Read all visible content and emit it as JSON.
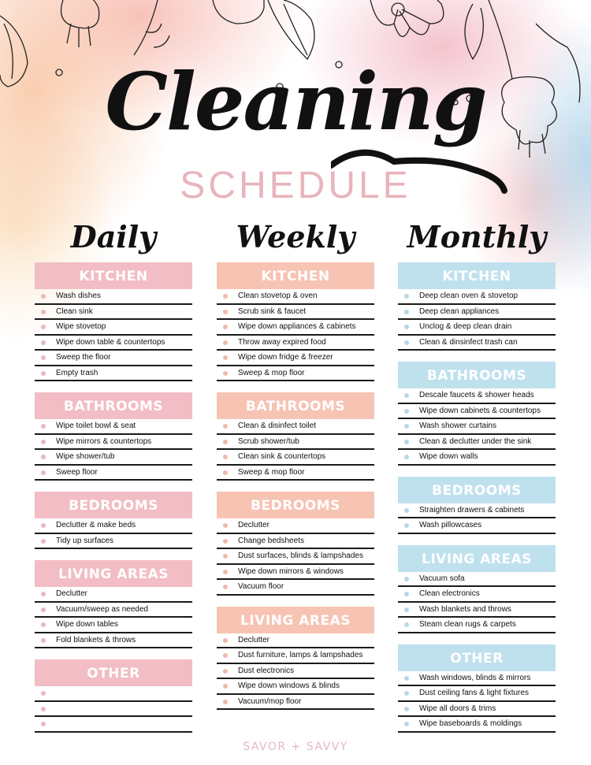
{
  "title": "Cleaning",
  "subtitle": "SCHEDULE",
  "footer": "SAVOR + SAVVY",
  "colors": {
    "daily_accent": "#f2bdc4",
    "weekly_accent": "#f7c3b3",
    "monthly_accent": "#bfe1ee",
    "subtitle": "#e8b4bc"
  },
  "icons": {
    "decor": "floral-line-art",
    "bullet": "dot"
  },
  "columns": [
    {
      "title": "Daily",
      "sections": [
        {
          "heading": "KITCHEN",
          "items": [
            "Wash dishes",
            "Clean sink",
            "Wipe stovetop",
            "Wipe down table & countertops",
            "Sweep the floor",
            "Empty trash"
          ]
        },
        {
          "heading": "BATHROOMS",
          "items": [
            "Wipe toilet bowl & seat",
            "Wipe mirrors & countertops",
            "Wipe shower/tub",
            "Sweep floor"
          ]
        },
        {
          "heading": "BEDROOMS",
          "items": [
            "Declutter & make beds",
            "Tidy up surfaces"
          ]
        },
        {
          "heading": "LIVING AREAS",
          "items": [
            "Declutter",
            "Vacuum/sweep as needed",
            "Wipe down tables",
            "Fold blankets & throws"
          ]
        },
        {
          "heading": "OTHER",
          "items": [
            "",
            "",
            ""
          ]
        }
      ]
    },
    {
      "title": "Weekly",
      "sections": [
        {
          "heading": "KITCHEN",
          "items": [
            "Clean stovetop & oven",
            "Scrub  sink & faucet",
            "Wipe down appliances & cabinets",
            "Throw away expired food",
            "Wipe down fridge & freezer",
            "Sweep & mop floor"
          ]
        },
        {
          "heading": "BATHROOMS",
          "items": [
            "Clean & disinfect toilet",
            "Scrub shower/tub",
            "Clean sink & countertops",
            "Sweep & mop floor"
          ]
        },
        {
          "heading": "BEDROOMS",
          "items": [
            "Declutter",
            "Change bedsheets",
            "Dust surfaces, blinds & lampshades",
            "Wipe down mirrors & windows",
            "Vacuum floor"
          ]
        },
        {
          "heading": "LIVING AREAS",
          "items": [
            "Declutter",
            "Dust furniture, lamps & lampshades",
            "Dust electronics",
            "Wipe down windows & blinds",
            "Vacuum/mop floor"
          ]
        }
      ]
    },
    {
      "title": "Monthly",
      "sections": [
        {
          "heading": "KITCHEN",
          "items": [
            "Deep clean oven & stovetop",
            "Deep clean appliances",
            "Unclog & deep clean drain",
            "Clean & dinsinfect trash can"
          ]
        },
        {
          "heading": "BATHROOMS",
          "items": [
            "Descale faucets & shower heads",
            "Wipe down cabinets & countertops",
            "Wash shower curtains",
            "Clean & declutter under the sink",
            "Wipe down walls"
          ]
        },
        {
          "heading": "BEDROOMS",
          "items": [
            "Straighten drawers & cabinets",
            "Wash pillowcases"
          ]
        },
        {
          "heading": "LIVING AREAS",
          "items": [
            "Vacuum sofa",
            "Clean electronics",
            "Wash blankets and throws",
            "Steam clean rugs & carpets"
          ]
        },
        {
          "heading": "OTHER",
          "items": [
            "Wash windows, blinds & mirrors",
            "Dust ceiling fans & light fixtures",
            "Wipe all doors & trims",
            "Wipe baseboards & moldings"
          ]
        }
      ]
    }
  ]
}
